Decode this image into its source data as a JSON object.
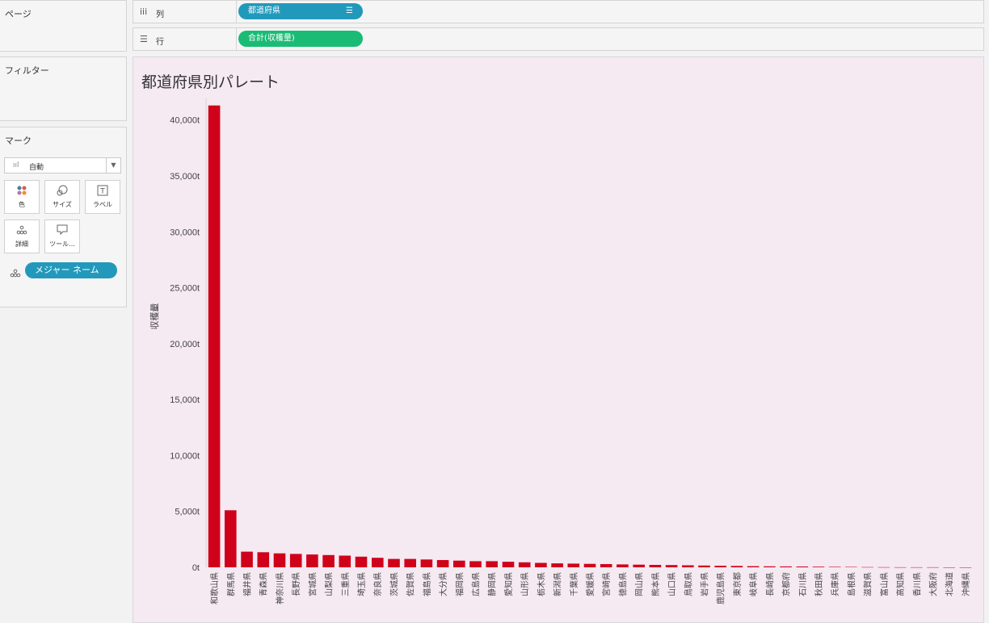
{
  "left_panel": {
    "pages_title": "ページ",
    "filters_title": "フィルター",
    "marks_title": "マーク",
    "mark_type": "自動",
    "mark_buttons": [
      {
        "label": "色",
        "icon": "color-dots-icon"
      },
      {
        "label": "サイズ",
        "icon": "size-circles-icon"
      },
      {
        "label": "ラベル",
        "icon": "label-t-icon"
      },
      {
        "label": "詳細",
        "icon": "detail-dots-icon"
      },
      {
        "label": "ツール...",
        "icon": "tooltip-speech-icon"
      }
    ],
    "detail_pill": "メジャー ネーム"
  },
  "shelves": {
    "columns_label": "列",
    "columns_pill": "都道府県",
    "rows_label": "行",
    "rows_pill": "合計(収穫量)"
  },
  "colors": {
    "bar": "#d0021b",
    "pill_dimension": "#2299bb",
    "pill_measure": "#1abc75",
    "viz_background": "#f5e9f2"
  },
  "chart_data": {
    "type": "bar",
    "title": "都道府県別パレート",
    "ylabel": "収穫量",
    "xlabel": "",
    "ylim": [
      0,
      42000
    ],
    "yticks": [
      0,
      5000,
      10000,
      15000,
      20000,
      25000,
      30000,
      35000,
      40000
    ],
    "ytick_labels": [
      "0t",
      "5,000t",
      "10,000t",
      "15,000t",
      "20,000t",
      "25,000t",
      "30,000t",
      "35,000t",
      "40,000t"
    ],
    "categories": [
      "和歌山県",
      "群馬県",
      "福井県",
      "青森県",
      "神奈川県",
      "長野県",
      "宮城県",
      "山梨県",
      "三重県",
      "埼玉県",
      "奈良県",
      "茨城県",
      "佐賀県",
      "福島県",
      "大分県",
      "福岡県",
      "広島県",
      "静岡県",
      "愛知県",
      "山形県",
      "栃木県",
      "新潟県",
      "千葉県",
      "愛媛県",
      "宮崎県",
      "徳島県",
      "岡山県",
      "熊本県",
      "山口県",
      "鳥取県",
      "岩手県",
      "鹿児島県",
      "東京都",
      "岐阜県",
      "長崎県",
      "京都府",
      "石川県",
      "秋田県",
      "兵庫県",
      "島根県",
      "滋賀県",
      "富山県",
      "高知県",
      "香川県",
      "大阪府",
      "北海道",
      "沖縄県"
    ],
    "values": [
      41300,
      5100,
      1400,
      1350,
      1250,
      1200,
      1150,
      1100,
      1050,
      950,
      850,
      750,
      750,
      700,
      650,
      600,
      550,
      550,
      500,
      450,
      400,
      350,
      330,
      310,
      290,
      260,
      240,
      220,
      200,
      180,
      160,
      140,
      120,
      100,
      90,
      80,
      70,
      55,
      45,
      35,
      25,
      15,
      10,
      8,
      5,
      3,
      2
    ]
  }
}
